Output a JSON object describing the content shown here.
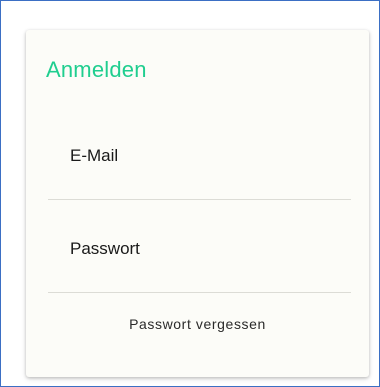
{
  "login_card": {
    "title": "Anmelden",
    "email_label": "E-Mail",
    "password_label": "Passwort",
    "forgot_password_label": "Passwort vergessen"
  },
  "colors": {
    "accent": "#1fce8f",
    "card_background": "#fcfcf8",
    "divider": "#dcdcd6",
    "frame_border": "#3b6fc4"
  }
}
